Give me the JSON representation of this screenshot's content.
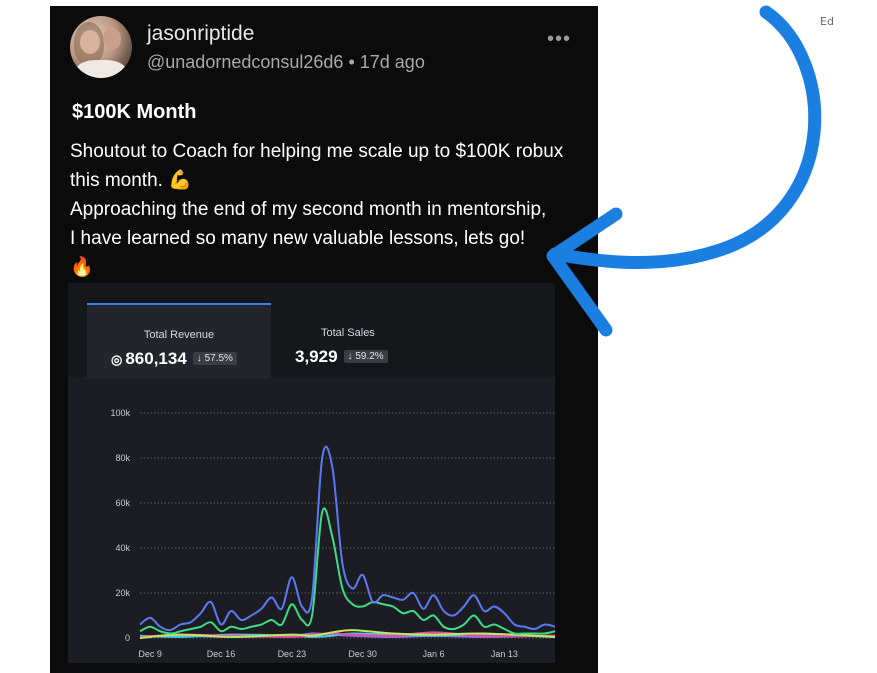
{
  "corner_text": "Ed",
  "post": {
    "username": "jasonriptide",
    "handle": "@unadornedconsul26d6",
    "time": "17d ago",
    "title": "$100K Month",
    "body": "Shoutout to Coach for helping me scale up to $100K robux\nthis month. 💪\nApproaching the end of my second month in mentorship,\nI have learned so many new valuable lessons, lets go!\n🔥",
    "icons": [
      "avatar-photo",
      "more-options-icon"
    ]
  },
  "dashboard": {
    "tabs": [
      {
        "label": "Total Revenue",
        "value": "860,134",
        "icon": "robux-icon",
        "delta": "↓ 57.5%",
        "active": true
      },
      {
        "label": "Total Sales",
        "value": "3,929",
        "delta": "↓ 59.2%",
        "active": false
      }
    ]
  },
  "chart_data": {
    "type": "line",
    "ylim": [
      0,
      100000
    ],
    "yticks": [
      "0",
      "20k",
      "40k",
      "60k",
      "80k",
      "100k"
    ],
    "xticks": [
      "Dec 9",
      "Dec 16",
      "Dec 23",
      "Dec 30",
      "Jan 6",
      "Jan 13"
    ],
    "x_days": [
      0,
      7,
      14,
      21,
      28,
      35
    ],
    "grid": true,
    "series": [
      {
        "color": "#5b79f5",
        "x": [
          -1,
          0,
          1,
          2,
          3,
          4,
          5,
          6,
          7,
          8,
          9,
          10,
          11,
          12,
          13,
          14,
          15,
          16,
          17,
          18,
          19,
          20,
          21,
          22,
          23,
          24,
          25,
          26,
          27,
          28,
          29,
          30,
          31,
          32,
          33,
          34,
          35,
          36,
          37,
          38,
          39,
          40
        ],
        "values": [
          6000,
          9000,
          5000,
          3500,
          6000,
          7000,
          11000,
          16000,
          6000,
          12000,
          8000,
          10000,
          13000,
          18000,
          13000,
          27000,
          14000,
          18000,
          80000,
          76000,
          33000,
          22000,
          28000,
          16000,
          19000,
          18000,
          17000,
          20000,
          13000,
          19000,
          12000,
          10000,
          14000,
          19000,
          12000,
          14000,
          11000,
          6000,
          5000,
          4000,
          6000,
          5000
        ]
      },
      {
        "color": "#3ddc84",
        "x": [
          -1,
          0,
          1,
          2,
          3,
          4,
          5,
          6,
          7,
          8,
          9,
          10,
          11,
          12,
          13,
          14,
          15,
          16,
          17,
          18,
          19,
          20,
          21,
          22,
          23,
          24,
          25,
          26,
          27,
          28,
          29,
          30,
          31,
          32,
          33,
          34,
          35,
          36,
          37,
          38,
          39,
          40
        ],
        "values": [
          3000,
          5000,
          3000,
          2000,
          3000,
          4000,
          5000,
          7000,
          3000,
          5000,
          4000,
          5000,
          6000,
          8000,
          6000,
          15000,
          8000,
          10000,
          56000,
          45000,
          22000,
          15000,
          14000,
          16000,
          15000,
          14000,
          11000,
          12000,
          8000,
          10000,
          5000,
          4000,
          6000,
          10000,
          5000,
          6000,
          4000,
          2000,
          2000,
          2000,
          2000,
          3000
        ]
      },
      {
        "color": "#c1e85c",
        "x": [
          -1,
          3,
          8,
          14,
          16,
          18,
          20,
          24,
          28,
          33,
          40
        ],
        "values": [
          0,
          1500,
          500,
          1500,
          1000,
          2500,
          3500,
          2000,
          1500,
          2000,
          500
        ]
      },
      {
        "color": "#e24ca4",
        "x": [
          -1,
          3,
          8,
          14,
          16,
          18,
          20,
          24,
          28,
          33,
          40
        ],
        "values": [
          500,
          1500,
          1000,
          500,
          1500,
          2000,
          1500,
          1000,
          2500,
          1000,
          1000
        ]
      },
      {
        "color": "#4ec9e8",
        "x": [
          -1,
          3,
          8,
          14,
          16,
          18,
          20,
          24,
          28,
          33,
          40
        ],
        "values": [
          1000,
          500,
          1500,
          1000,
          500,
          1000,
          2000,
          1500,
          1000,
          1500,
          500
        ]
      },
      {
        "color": "#9a6cf0",
        "x": [
          -1,
          3,
          8,
          14,
          16,
          18,
          20,
          24,
          28,
          33,
          40
        ],
        "values": [
          500,
          1000,
          500,
          1000,
          2000,
          1500,
          1000,
          500,
          1000,
          500,
          1000
        ]
      }
    ]
  }
}
